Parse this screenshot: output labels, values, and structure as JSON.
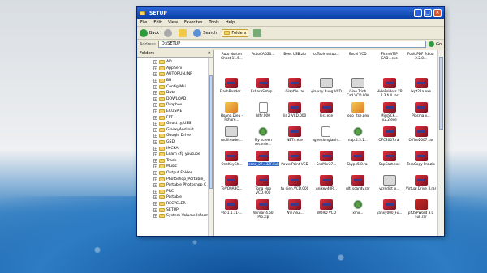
{
  "window": {
    "title": "SETUP",
    "controls": [
      "_",
      "□",
      "✕"
    ]
  },
  "menu": [
    "File",
    "Edit",
    "View",
    "Favorites",
    "Tools",
    "Help"
  ],
  "toolbar": {
    "back_label": "Back",
    "search_label": "Search",
    "folders_label": "Folders"
  },
  "address": {
    "label": "Address",
    "value": "D:\\SETUP",
    "go_label": "Go"
  },
  "folders_pane": {
    "title": "Folders",
    "close": "✕",
    "items": [
      "AD",
      "AppServ",
      "AUTORUN.INF",
      "BB",
      "Config.Msi",
      "Data",
      "DOWLOAD",
      "Dropbox",
      "ECUSPIE",
      "FPT",
      "Ghost ty/USB",
      "GiaoxyAndroid",
      "Google Drive",
      "GSD",
      "IMCKA",
      "Learn cfg youtube",
      "Track",
      "Music",
      "Output Folder",
      "Photoshop_Portable_",
      "Portable Photoshop C",
      "PRC",
      "Portable",
      "RECYCLER",
      "SETUP",
      "System Volume Inform"
    ]
  },
  "files": [
    {
      "name": "Auto Norton Ghost 11.5...",
      "type": "rar",
      "row": "top"
    },
    {
      "name": "AutoCAD20...",
      "type": "rar",
      "row": "top"
    },
    {
      "name": "Bees USB.zip",
      "type": "rar",
      "row": "top"
    },
    {
      "name": "ccTools setup...",
      "type": "rar",
      "row": "top"
    },
    {
      "name": "Excel VCD",
      "type": "rar",
      "row": "top"
    },
    {
      "name": "FirmsVMP CAD...exe",
      "type": "rar",
      "row": "top"
    },
    {
      "name": "Foxit PDF Editor 2.2.8...",
      "type": "rar",
      "row": "top"
    },
    {
      "name": "FlashReader...",
      "type": "rar"
    },
    {
      "name": "FshareSetup...",
      "type": "rar"
    },
    {
      "name": "Giapfile.rar",
      "type": "rar"
    },
    {
      "name": "gia xay dung VCD",
      "type": "exe"
    },
    {
      "name": "Giao Trinh Cad.VCD.000",
      "type": "exe"
    },
    {
      "name": "HideFolders XP 2.3 full.rar",
      "type": "rar"
    },
    {
      "name": "Ixpt22a.exe",
      "type": "rar"
    },
    {
      "name": "Hoang.Dieu - Fshare...",
      "type": "img"
    },
    {
      "name": "Idflr.000",
      "type": "doc"
    },
    {
      "name": "lis 2.VCD.000",
      "type": "rar"
    },
    {
      "name": "Ilist.exe",
      "type": "rar"
    },
    {
      "name": "logo_ltse.png",
      "type": "img"
    },
    {
      "name": "MissSCK... v2.2.exe",
      "type": "rar"
    },
    {
      "name": "Plasma.v...",
      "type": "rar"
    },
    {
      "name": "muifreader...",
      "type": "exe"
    },
    {
      "name": "My screen recorde...",
      "type": "gear"
    },
    {
      "name": "NET4.exe",
      "type": "rar"
    },
    {
      "name": "nghe dongianh...",
      "type": "doc"
    },
    {
      "name": "nap.4.5.1...",
      "type": "gear"
    },
    {
      "name": "OFC2007.rar",
      "type": "rar"
    },
    {
      "name": "Office2007.rar",
      "type": "rar"
    },
    {
      "name": "OneKeyGh...",
      "type": "rar"
    },
    {
      "name": "Onenote.rar",
      "type": "rar"
    },
    {
      "name": "PowerPoint VCD",
      "type": "rar"
    },
    {
      "name": "SnsMkr27...",
      "type": "rar"
    },
    {
      "name": "Skype5.8.rar",
      "type": "rar"
    },
    {
      "name": "SopCast.exe",
      "type": "rar"
    },
    {
      "name": "TeraCopy Pro.zip",
      "type": "rar"
    },
    {
      "name": "TeVQ9ABO...",
      "type": "rar"
    },
    {
      "name": "Tong Hop VCD.000",
      "type": "rar"
    },
    {
      "name": "tu dien.VCD.000",
      "type": "rar"
    },
    {
      "name": "unikey40R...",
      "type": "rar"
    },
    {
      "name": "ulti scandy.rar",
      "type": "rar"
    },
    {
      "name": "vcredist_x...",
      "type": "exe"
    },
    {
      "name": "Virtual Drive 3.rar",
      "type": "rar"
    },
    {
      "name": "vlc-1.1.11-...",
      "type": "rar"
    },
    {
      "name": "Winrar 4.50 Pro.zip",
      "type": "rar"
    },
    {
      "name": "Win7Bi2...",
      "type": "rar"
    },
    {
      "name": "WORD VCD",
      "type": "rar"
    },
    {
      "name": "xmx...",
      "type": "gear"
    },
    {
      "name": "yanxy000_Fu...",
      "type": "rar"
    },
    {
      "name": "pfDSPWord 3.0 Full.rar",
      "type": "pdf"
    }
  ],
  "selected_file_index": 29,
  "selected_file_label": "Corona_27...3ZF.Full.exe"
}
